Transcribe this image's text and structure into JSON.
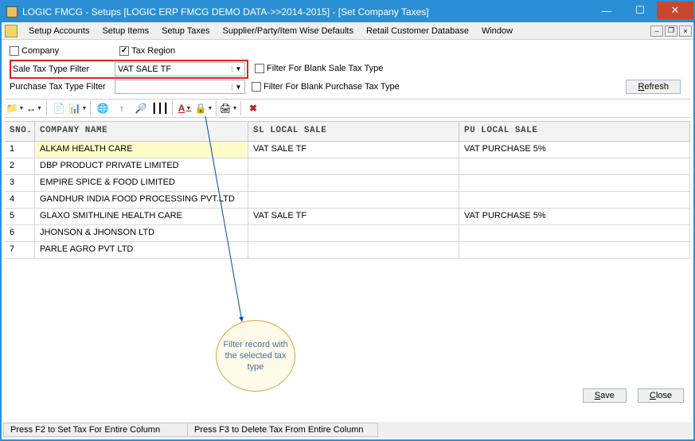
{
  "window": {
    "title": "LOGIC FMCG - Setups  [LOGIC ERP FMCG DEMO DATA->>2014-2015] - [Set Company Taxes]"
  },
  "menubar": {
    "items": [
      "Setup Accounts",
      "Setup Items",
      "Setup Taxes",
      "Supplier/Party/Item Wise Defaults",
      "Retail Customer Database",
      "Window"
    ]
  },
  "filters": {
    "company_label": "Company",
    "company_checked": false,
    "taxregion_label": "Tax Region",
    "taxregion_checked": true,
    "sale_label": "Sale Tax Type Filter",
    "sale_value": "VAT SALE TF",
    "blank_sale_label": "Filter For Blank Sale Tax Type",
    "blank_sale_checked": false,
    "purchase_label": "Purchase Tax Type Filter",
    "purchase_value": "",
    "blank_purchase_label": "Filter For Blank Purchase Tax Type",
    "blank_purchase_checked": false,
    "refresh": "Refresh"
  },
  "grid": {
    "headers": {
      "sno": "SNO.",
      "name": "COMPANY NAME",
      "sl": "SL LOCAL SALE",
      "pu": "PU LOCAL SALE"
    },
    "rows": [
      {
        "sno": "1",
        "name": "ALKAM HEALTH CARE",
        "sl": "VAT SALE TF",
        "pu": "VAT PURCHASE 5%"
      },
      {
        "sno": "2",
        "name": "DBP PRODUCT PRIVATE LIMITED",
        "sl": "",
        "pu": ""
      },
      {
        "sno": "3",
        "name": "EMPIRE SPICE & FOOD LIMITED",
        "sl": "",
        "pu": ""
      },
      {
        "sno": "4",
        "name": "GANDHUR INDIA FOOD PROCESSING PVT.LTD",
        "sl": "",
        "pu": ""
      },
      {
        "sno": "5",
        "name": "GLAXO SMITHLINE HEALTH CARE",
        "sl": "VAT SALE TF",
        "pu": "VAT PURCHASE 5%"
      },
      {
        "sno": "6",
        "name": "JHONSON & JHONSON LTD",
        "sl": "",
        "pu": ""
      },
      {
        "sno": "7",
        "name": "PARLE AGRO PVT LTD",
        "sl": "",
        "pu": ""
      }
    ]
  },
  "callout": "Filter record with the selected tax type",
  "buttons": {
    "save": "Save",
    "close": "Close"
  },
  "status": {
    "f2": "Press F2 to Set Tax For Entire Column",
    "f3": "Press F3 to Delete Tax From Entire Column"
  },
  "toolbar_icons": {
    "open": "📁",
    "fit": "↔",
    "copy": "📄",
    "excel": "📊",
    "globe": "🌐",
    "up": "↑",
    "find": "🔍",
    "chart": "📊",
    "font": "A",
    "lock": "🔒",
    "print": "🖨",
    "del": "✖"
  }
}
